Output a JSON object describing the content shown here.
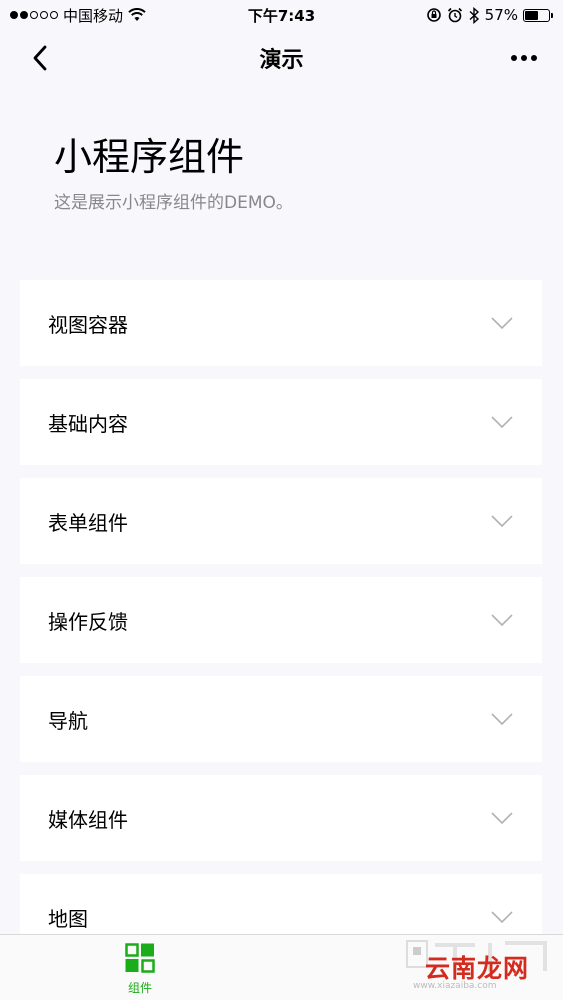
{
  "status_bar": {
    "carrier": "中国移动",
    "time": "下午7:43",
    "battery_percent": "57%",
    "battery_level": 0.57,
    "signal_strength": 2
  },
  "nav": {
    "title": "演示"
  },
  "header": {
    "title": "小程序组件",
    "description": "这是展示小程序组件的DEMO。"
  },
  "menu": {
    "items": [
      {
        "label": "视图容器"
      },
      {
        "label": "基础内容"
      },
      {
        "label": "表单组件"
      },
      {
        "label": "操作反馈"
      },
      {
        "label": "导航"
      },
      {
        "label": "媒体组件"
      },
      {
        "label": "地图"
      }
    ]
  },
  "tab_bar": {
    "items": [
      {
        "label": "组件",
        "active": true,
        "color": "#1aad19"
      }
    ]
  },
  "watermark": {
    "text": "云南龙网",
    "url": "www.xiazaiba.com"
  },
  "colors": {
    "accent": "#1aad19",
    "background": "#f8f7fb",
    "card": "#ffffff",
    "secondary_text": "#888888",
    "chevron": "#b2b2b2"
  }
}
